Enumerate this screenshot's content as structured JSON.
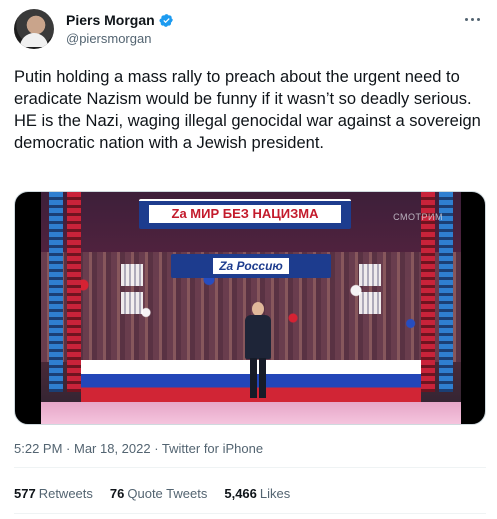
{
  "author": {
    "display_name": "Piers Morgan",
    "handle": "@piersmorgan",
    "verified": true
  },
  "tweet": {
    "text": "Putin holding a mass rally to preach about the urgent need to eradicate Nazism would be funny if it wasn’t so deadly serious.\nHE is the Nazi, waging illegal genocidal war against a sovereign democratic nation with a Jewish president."
  },
  "media": {
    "banner_top": "Zа МИР БЕЗ НАЦИЗМА",
    "banner_mid": "Zа Россию",
    "watermark": "СМОТРИМ"
  },
  "meta": {
    "time": "5:22 PM",
    "separator1": " · ",
    "date": "Mar 18, 2022",
    "separator2": " · ",
    "source": "Twitter for iPhone"
  },
  "stats": {
    "retweets_count": "577",
    "retweets_label": "Retweets",
    "quotes_count": "76",
    "quotes_label": "Quote Tweets",
    "likes_count": "5,466",
    "likes_label": "Likes"
  },
  "colors": {
    "text_primary": "#0f1419",
    "text_secondary": "#536471",
    "verified_blue": "#1d9bf0",
    "divider": "#eff3f4"
  },
  "icons": {
    "verified": "verified-badge-icon",
    "more": "more-horizontal-icon"
  }
}
